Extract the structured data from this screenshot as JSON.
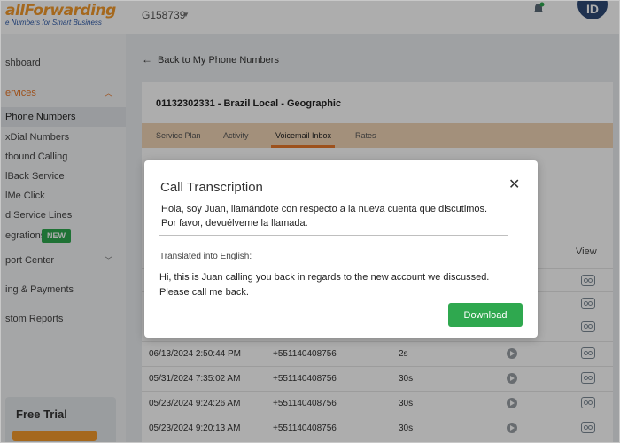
{
  "header": {
    "logo_text": "allForwarding",
    "logo_tagline": "e Numbers for Smart Business",
    "account_id": "G158739",
    "avatar_initials": "ID"
  },
  "sidebar": {
    "items": [
      {
        "label": "shboard"
      },
      {
        "label": "ervices"
      },
      {
        "label": "Phone Numbers"
      },
      {
        "label": "xDial Numbers"
      },
      {
        "label": "tbound Calling"
      },
      {
        "label": "lBack Service"
      },
      {
        "label": "lMe Click"
      },
      {
        "label": "d Service Lines"
      },
      {
        "label": "egrations",
        "badge": "NEW"
      },
      {
        "label": "port Center"
      },
      {
        "label": "ing & Payments"
      },
      {
        "label": "stom Reports"
      }
    ],
    "free_trial": "Free Trial"
  },
  "main": {
    "back_link": "Back to My Phone Numbers",
    "number_title": "01132302331 - Brazil Local - Geographic",
    "tabs": [
      {
        "label": "Service Plan"
      },
      {
        "label": "Activity"
      },
      {
        "label": "Voicemail Inbox",
        "active": true
      },
      {
        "label": "Rates"
      }
    ],
    "table": {
      "view_header": "View",
      "rows": [
        {
          "date": "",
          "from": "",
          "duration": ""
        },
        {
          "date": "",
          "from": "",
          "duration": ""
        },
        {
          "date": "",
          "from": "",
          "duration": ""
        },
        {
          "date": "06/13/2024 2:50:44 PM",
          "from": "+551140408756",
          "duration": "2s"
        },
        {
          "date": "05/31/2024 7:35:02 AM",
          "from": "+551140408756",
          "duration": "30s"
        },
        {
          "date": "05/23/2024 9:24:26 AM",
          "from": "+551140408756",
          "duration": "30s"
        },
        {
          "date": "05/23/2024 9:20:13 AM",
          "from": "+551140408756",
          "duration": "30s"
        }
      ]
    }
  },
  "modal": {
    "title": "Call Transcription",
    "close_glyph": "✕",
    "original_line1": "Hola, soy Juan, llamándote con respecto a la nueva cuenta que discutimos.",
    "original_line2": "Por favor, devuélveme la llamada.",
    "translated_label": "Translated into English:",
    "translated_line1": "Hi, this is Juan calling you back in regards to the new account we discussed.",
    "translated_line2": "Please call me back.",
    "download_label": "Download"
  },
  "colors": {
    "accent_orange": "#e8782a",
    "tab_bar": "#f1d4b5",
    "download_green": "#2fa84f",
    "avatar_navy": "#2f4b76"
  },
  "icons": {
    "back": "arrow-left-icon",
    "close": "close-icon",
    "notifications": "bell-icon",
    "play": "play-icon",
    "view": "voicemail-icon",
    "expand": "chevron-icon"
  }
}
